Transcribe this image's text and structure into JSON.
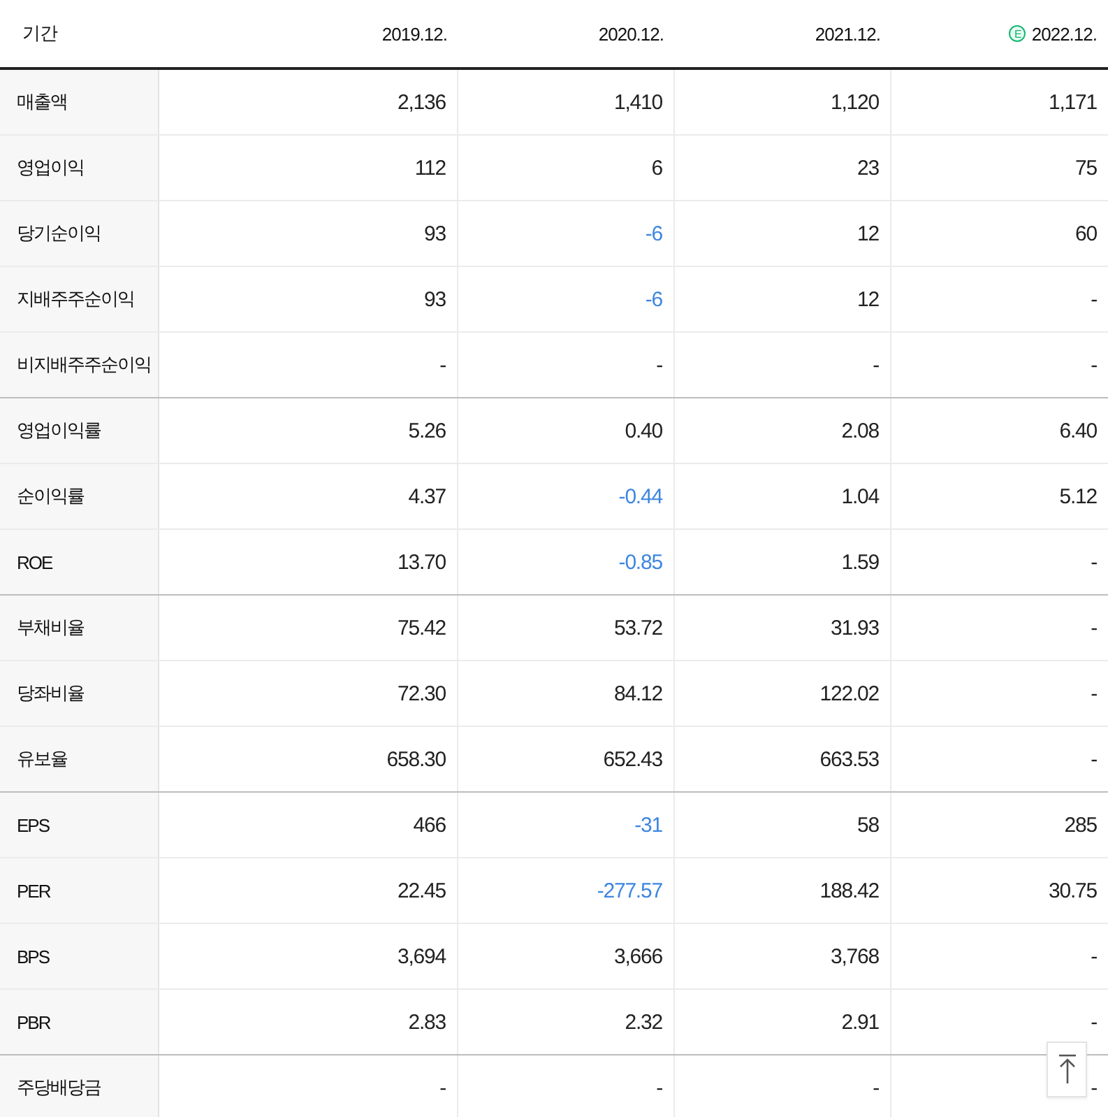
{
  "table": {
    "columns": [
      {
        "label": "기간"
      },
      {
        "label": "2019.12."
      },
      {
        "label": "2020.12."
      },
      {
        "label": "2021.12."
      },
      {
        "label": "2022.12.",
        "badge": "E"
      }
    ],
    "rows": [
      {
        "label": "매출액",
        "group_end": false,
        "values": [
          {
            "text": "2,136",
            "negative": false
          },
          {
            "text": "1,410",
            "negative": false
          },
          {
            "text": "1,120",
            "negative": false
          },
          {
            "text": "1,171",
            "negative": false
          }
        ]
      },
      {
        "label": "영업이익",
        "group_end": false,
        "values": [
          {
            "text": "112",
            "negative": false
          },
          {
            "text": "6",
            "negative": false
          },
          {
            "text": "23",
            "negative": false
          },
          {
            "text": "75",
            "negative": false
          }
        ]
      },
      {
        "label": "당기순이익",
        "group_end": false,
        "values": [
          {
            "text": "93",
            "negative": false
          },
          {
            "text": "-6",
            "negative": true
          },
          {
            "text": "12",
            "negative": false
          },
          {
            "text": "60",
            "negative": false
          }
        ]
      },
      {
        "label": "지배주주순이익",
        "group_end": false,
        "values": [
          {
            "text": "93",
            "negative": false
          },
          {
            "text": "-6",
            "negative": true
          },
          {
            "text": "12",
            "negative": false
          },
          {
            "text": "-",
            "negative": false
          }
        ]
      },
      {
        "label": "비지배주주순이익",
        "group_end": true,
        "values": [
          {
            "text": "-",
            "negative": false
          },
          {
            "text": "-",
            "negative": false
          },
          {
            "text": "-",
            "negative": false
          },
          {
            "text": "-",
            "negative": false
          }
        ]
      },
      {
        "label": "영업이익률",
        "group_end": false,
        "values": [
          {
            "text": "5.26",
            "negative": false
          },
          {
            "text": "0.40",
            "negative": false
          },
          {
            "text": "2.08",
            "negative": false
          },
          {
            "text": "6.40",
            "negative": false
          }
        ]
      },
      {
        "label": "순이익률",
        "group_end": false,
        "values": [
          {
            "text": "4.37",
            "negative": false
          },
          {
            "text": "-0.44",
            "negative": true
          },
          {
            "text": "1.04",
            "negative": false
          },
          {
            "text": "5.12",
            "negative": false
          }
        ]
      },
      {
        "label": "ROE",
        "group_end": true,
        "values": [
          {
            "text": "13.70",
            "negative": false
          },
          {
            "text": "-0.85",
            "negative": true
          },
          {
            "text": "1.59",
            "negative": false
          },
          {
            "text": "-",
            "negative": false
          }
        ]
      },
      {
        "label": "부채비율",
        "group_end": false,
        "values": [
          {
            "text": "75.42",
            "negative": false
          },
          {
            "text": "53.72",
            "negative": false
          },
          {
            "text": "31.93",
            "negative": false
          },
          {
            "text": "-",
            "negative": false
          }
        ]
      },
      {
        "label": "당좌비율",
        "group_end": false,
        "values": [
          {
            "text": "72.30",
            "negative": false
          },
          {
            "text": "84.12",
            "negative": false
          },
          {
            "text": "122.02",
            "negative": false
          },
          {
            "text": "-",
            "negative": false
          }
        ]
      },
      {
        "label": "유보율",
        "group_end": true,
        "values": [
          {
            "text": "658.30",
            "negative": false
          },
          {
            "text": "652.43",
            "negative": false
          },
          {
            "text": "663.53",
            "negative": false
          },
          {
            "text": "-",
            "negative": false
          }
        ]
      },
      {
        "label": "EPS",
        "group_end": false,
        "values": [
          {
            "text": "466",
            "negative": false
          },
          {
            "text": "-31",
            "negative": true
          },
          {
            "text": "58",
            "negative": false
          },
          {
            "text": "285",
            "negative": false
          }
        ]
      },
      {
        "label": "PER",
        "group_end": false,
        "values": [
          {
            "text": "22.45",
            "negative": false
          },
          {
            "text": "-277.57",
            "negative": true
          },
          {
            "text": "188.42",
            "negative": false
          },
          {
            "text": "30.75",
            "negative": false
          }
        ]
      },
      {
        "label": "BPS",
        "group_end": false,
        "values": [
          {
            "text": "3,694",
            "negative": false
          },
          {
            "text": "3,666",
            "negative": false
          },
          {
            "text": "3,768",
            "negative": false
          },
          {
            "text": "-",
            "negative": false
          }
        ]
      },
      {
        "label": "PBR",
        "group_end": true,
        "values": [
          {
            "text": "2.83",
            "negative": false
          },
          {
            "text": "2.32",
            "negative": false
          },
          {
            "text": "2.91",
            "negative": false
          },
          {
            "text": "-",
            "negative": false
          }
        ]
      },
      {
        "label": "주당배당금",
        "values": [
          {
            "text": "-",
            "negative": false
          },
          {
            "text": "-",
            "negative": false
          },
          {
            "text": "-",
            "negative": false
          },
          {
            "text": "-",
            "negative": false
          }
        ]
      }
    ]
  }
}
